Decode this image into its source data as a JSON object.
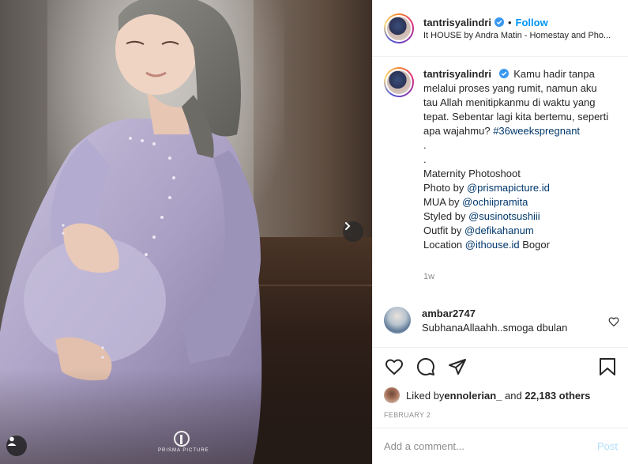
{
  "post": {
    "image_alt": "Maternity photo",
    "watermark": "PRISMA PICTURE",
    "icons": {
      "next": "chevron-right-icon",
      "tag": "user-tag-icon"
    }
  },
  "header": {
    "username": "tantrisyalindri",
    "separator": "•",
    "follow_label": "Follow",
    "location": "It HOUSE by Andra Matin - Homestay and Pho..."
  },
  "caption": {
    "username": "tantrisyalindri",
    "intro": "Kamu hadir tanpa melalui proses yang rumit, namun aku tau Allah menitipkanmu di waktu yang tepat. Sebentar lagi kita bertemu, seperti apa wajahmu?",
    "hashtag": "#36weekspregnant",
    "dot1": ".",
    "dot2": ".",
    "line_title": "Maternity Photoshoot",
    "photo_prefix": "Photo by ",
    "photo_handle": "@prismapicture.id",
    "mua_prefix": "MUA by ",
    "mua_handle": "@ochiipramita",
    "styled_prefix": "Styled by ",
    "styled_handle": "@susinotsushiii",
    "outfit_prefix": "Outfit by ",
    "outfit_handle": "@defikahanum",
    "location_prefix": "Location ",
    "location_handle": "@ithouse.id",
    "location_suffix": " Bogor",
    "time": "1w"
  },
  "comment": {
    "username": "ambar2747",
    "text": "SubhanaAllaahh..smoga dbulan"
  },
  "likes": {
    "prefix": "Liked by ",
    "user": "ennolerian_",
    "middle": " and ",
    "count": "22,183 others"
  },
  "date": "FEBRUARY 2",
  "add_comment": {
    "placeholder": "Add a comment...",
    "post_label": "Post"
  },
  "colors": {
    "accent": "#0095f6",
    "link": "#00376b",
    "muted": "#8e8e8e",
    "post_disabled": "#b2dffc"
  }
}
